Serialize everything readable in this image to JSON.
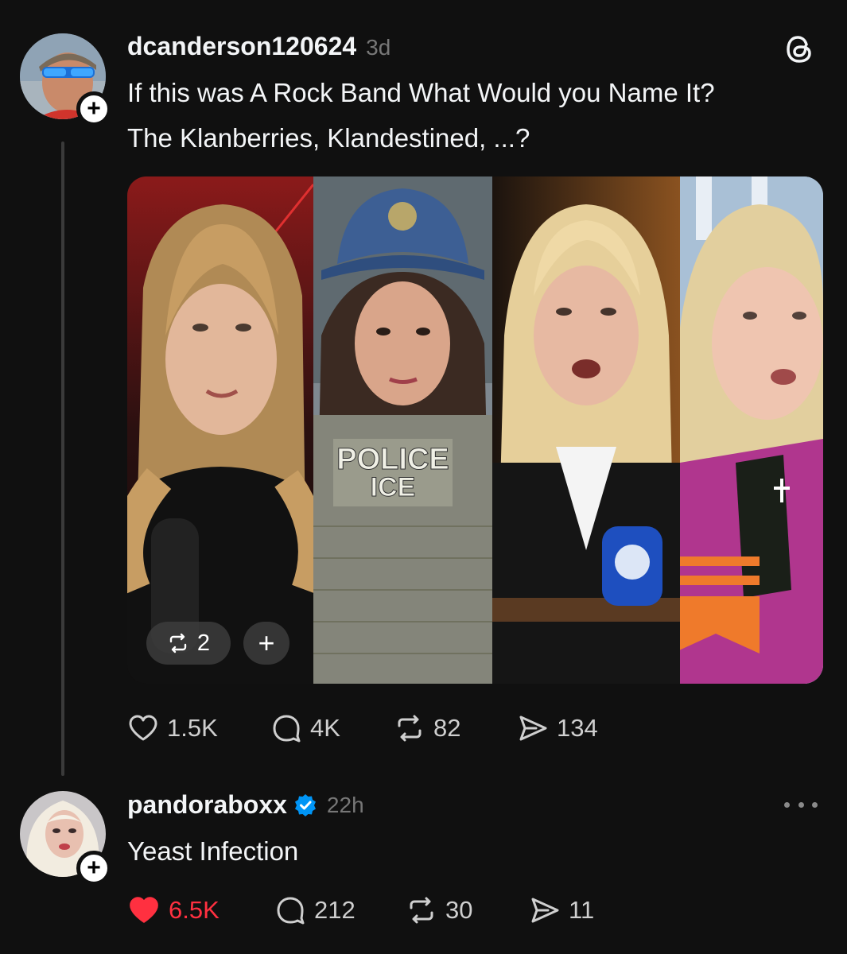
{
  "post": {
    "username": "dcanderson120624",
    "time": "3d",
    "line1": "If this was A Rock Band What Would you Name It?",
    "line2": "The Klanberries, Klandestined, ...?",
    "media": {
      "repost_count": "2",
      "vest_line1": "POLICE",
      "vest_line2": "ICE"
    },
    "actions": {
      "likes": "1.5K",
      "replies": "4K",
      "reposts": "82",
      "shares": "134"
    }
  },
  "reply": {
    "username": "pandoraboxx",
    "time": "22h",
    "text": "Yeast Infection",
    "liked": true,
    "actions": {
      "likes": "6.5K",
      "replies": "212",
      "reposts": "30",
      "shares": "11"
    }
  },
  "colors": {
    "background": "#101010",
    "like_active": "#ff3040",
    "verified": "#0095f6"
  },
  "icons": [
    "threads-logo-icon",
    "follow-plus-icon",
    "heart-icon",
    "comment-icon",
    "repost-icon",
    "share-icon",
    "verified-badge-icon",
    "more-icon"
  ]
}
